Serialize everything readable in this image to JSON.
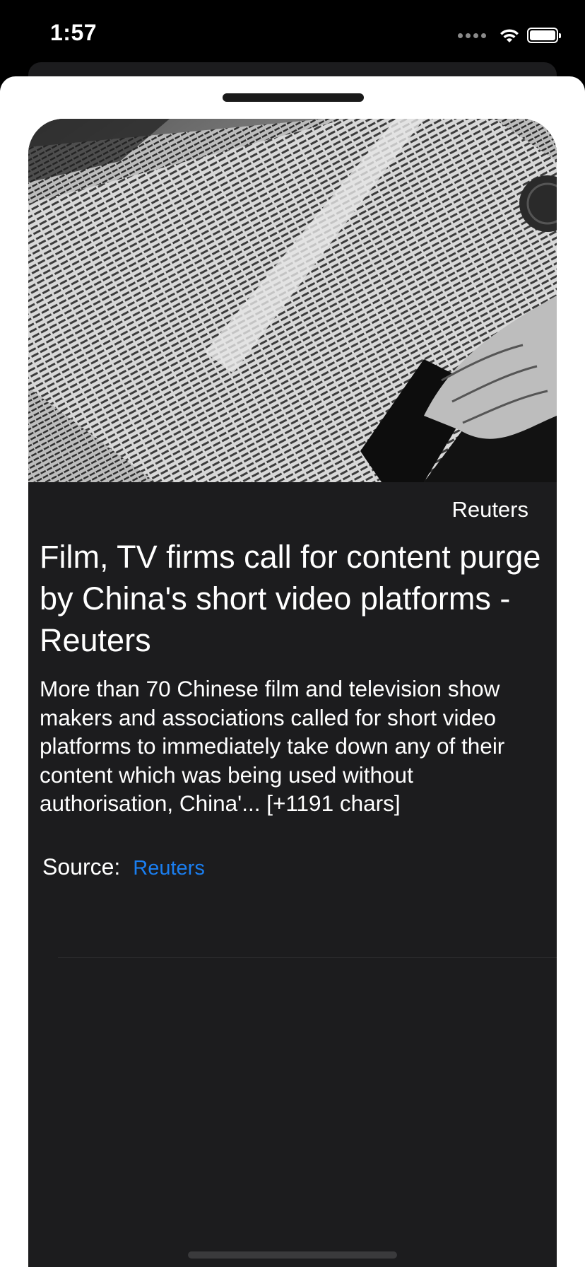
{
  "status_bar": {
    "time": "1:57"
  },
  "article": {
    "source_name": "Reuters",
    "title": "Film, TV firms call for content purge by China's short video platforms - Reuters",
    "description": "More than 70 Chinese film and television show makers and associations called for short video platforms to immediately take down any of their content which was being used without authorisation, China'... [+1191 chars]",
    "source_label": "Source:",
    "source_link": "Reuters"
  },
  "colors": {
    "card_bg": "#1c1c1e",
    "link": "#1a7ef0",
    "sheet_bg": "#ffffff"
  },
  "icons": [
    "signal-icon",
    "wifi-icon",
    "battery-icon"
  ]
}
